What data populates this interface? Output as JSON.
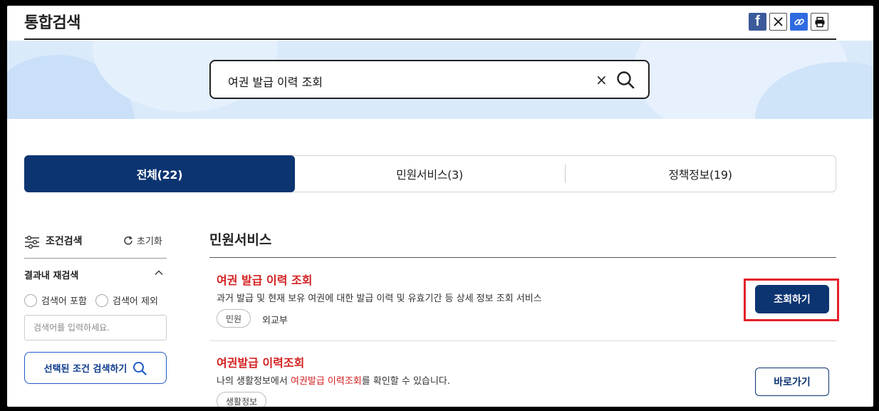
{
  "header": {
    "title": "통합검색",
    "share_icons": [
      "facebook-icon",
      "x-icon",
      "link-icon",
      "print-icon"
    ]
  },
  "search": {
    "query": "여권 발급 이력 조회",
    "clear_icon": "×"
  },
  "tabs": [
    {
      "label": "전체(22)",
      "active": true
    },
    {
      "label": "민원서비스(3)",
      "active": false
    },
    {
      "label": "정책정보(19)",
      "active": false
    }
  ],
  "sidebar": {
    "filter_label": "조건검색",
    "reset_label": "초기화",
    "within_label": "결과내 재검색",
    "include_label": "검색어 포함",
    "exclude_label": "검색어 제외",
    "input_placeholder": "검색어를 입력하세요.",
    "search_button": "선택된 조건 검색하기"
  },
  "main": {
    "section_title": "민원서비스",
    "results": [
      {
        "title": "여권 발급 이력 조회",
        "description": "과거 발급 및 현재 보유 여권에 대한 발급 이력 및 유효기간 등 상세 정보 조회 서비스",
        "tag": "민원",
        "org": "외교부",
        "button": "조회하기"
      },
      {
        "title": "여권발급 이력조회",
        "desc_prefix": "나의 생활정보에서 ",
        "desc_highlight": "여권발급 이력조회",
        "desc_suffix": "를 확인할 수 있습니다.",
        "tag": "생활정보",
        "button": "바로가기"
      }
    ]
  },
  "colors": {
    "navy": "#0c3471",
    "highlight_red": "#d42020",
    "annotation_red": "#e4202a",
    "hero_bg": "#dbeafb"
  }
}
